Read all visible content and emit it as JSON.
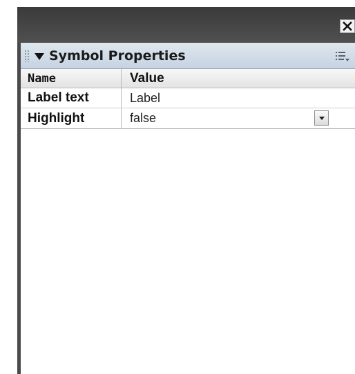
{
  "panel": {
    "title": "Symbol Properties"
  },
  "grid": {
    "columns": [
      "Name",
      "Value"
    ],
    "rows": [
      {
        "name": "Label text",
        "value": "Label"
      },
      {
        "name": "Highlight",
        "value": "false"
      }
    ]
  }
}
